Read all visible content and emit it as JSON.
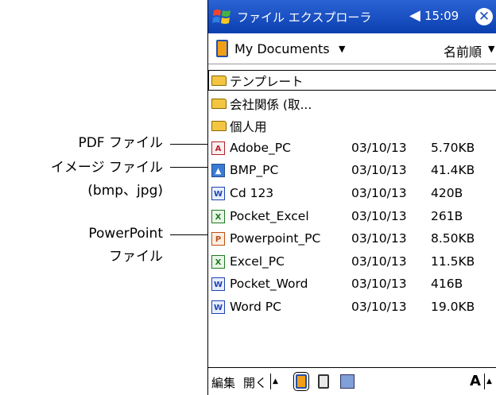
{
  "callouts": {
    "pdf": "PDF ファイル",
    "image_line1": "イメージ ファイル",
    "image_line2": "(bmp、jpg)",
    "ppt_line1": "PowerPoint",
    "ppt_line2": "ファイル"
  },
  "titlebar": {
    "title": "ファイル エクスプローラ",
    "time": "15:09",
    "volume_icon": "speaker-icon",
    "close_icon": "close-icon"
  },
  "folderbar": {
    "folder": "My Documents",
    "sort": "名前順"
  },
  "files": [
    {
      "icon": "folder-icon",
      "name": "テンプレート",
      "date": "",
      "size": ""
    },
    {
      "icon": "folder-icon",
      "name": "会社関係 (取...",
      "date": "",
      "size": ""
    },
    {
      "icon": "folder-icon",
      "name": "個人用",
      "date": "",
      "size": ""
    },
    {
      "icon": "pdf-icon",
      "name": "Adobe_PC",
      "date": "03/10/13",
      "size": "5.70KB"
    },
    {
      "icon": "bmp-icon",
      "name": "BMP_PC",
      "date": "03/10/13",
      "size": "41.4KB"
    },
    {
      "icon": "word-icon",
      "name": "Cd 123",
      "date": "03/10/13",
      "size": "420B"
    },
    {
      "icon": "excel-icon",
      "name": "Pocket_Excel",
      "date": "03/10/13",
      "size": "261B"
    },
    {
      "icon": "powerpoint-icon",
      "name": "Powerpoint_PC",
      "date": "03/10/13",
      "size": "8.50KB"
    },
    {
      "icon": "excel-icon",
      "name": "Excel_PC",
      "date": "03/10/13",
      "size": "11.5KB"
    },
    {
      "icon": "word-icon",
      "name": "Pocket_Word",
      "date": "03/10/13",
      "size": "416B"
    },
    {
      "icon": "word-icon",
      "name": "Word PC",
      "date": "03/10/13",
      "size": "19.0KB"
    }
  ],
  "menubar": {
    "edit": "編集",
    "open": "開く",
    "font_label": "A"
  },
  "colors": {
    "titlebar": "#1b4fc0",
    "folder": "#f4c542"
  }
}
